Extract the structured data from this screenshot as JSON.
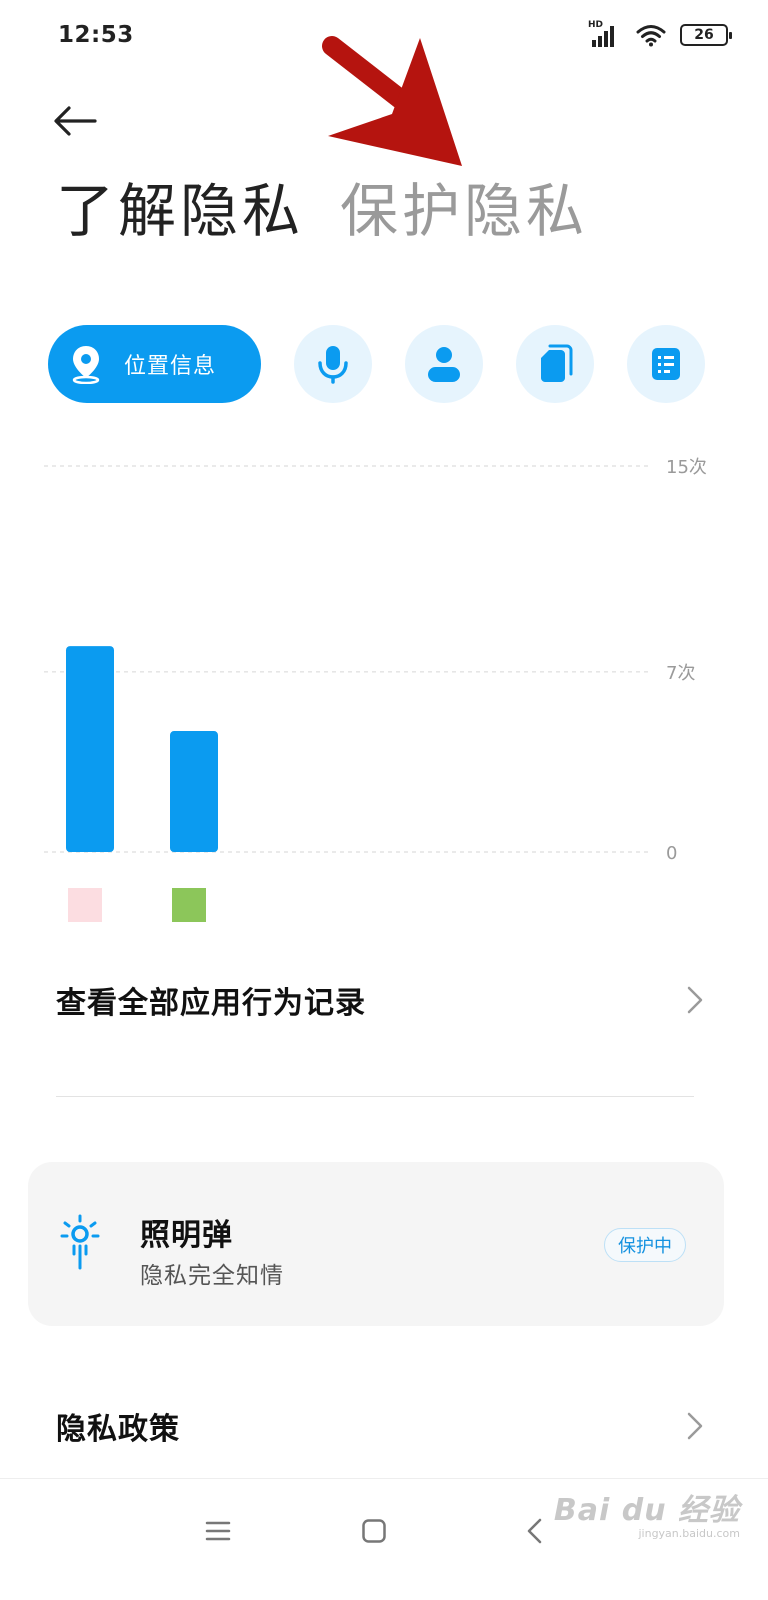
{
  "status_bar": {
    "time": "12:53",
    "network_label": "HD",
    "battery": "26",
    "icons": [
      "signal-icon",
      "wifi-icon",
      "battery-icon"
    ]
  },
  "header": {
    "back_icon": "arrow-left-icon",
    "tabs": [
      {
        "label": "了解隐私",
        "active": true
      },
      {
        "label": "保护隐私",
        "active": false
      }
    ]
  },
  "categories": [
    {
      "label": "位置信息",
      "icon": "location-pin-icon",
      "active": true
    },
    {
      "label": "",
      "icon": "microphone-icon",
      "active": false
    },
    {
      "label": "",
      "icon": "contact-person-icon",
      "active": false
    },
    {
      "label": "",
      "icon": "files-icon",
      "active": false
    },
    {
      "label": "",
      "icon": "list-document-icon",
      "active": false
    }
  ],
  "chart_data": {
    "type": "bar",
    "values": [
      8,
      4.7
    ],
    "categories": [
      "",
      ""
    ],
    "category_colors": [
      "#fcdde1",
      "#8cc65a"
    ],
    "bar_color": "#0b9bf0",
    "y_ticks": [
      "15次",
      "7次",
      "0"
    ],
    "y_tick_values": [
      15,
      7,
      0
    ],
    "ylim": [
      0,
      15
    ],
    "grid": true
  },
  "rows": {
    "all_records": {
      "label": "查看全部应用行为记录"
    },
    "privacy_policy": {
      "label": "隐私政策"
    }
  },
  "feature_card": {
    "title": "照明弹",
    "subtitle": "隐私完全知情",
    "status": "保护中",
    "icon": "flare-icon"
  },
  "nav_bar": {
    "icons": [
      "menu-icon",
      "home-square-icon",
      "back-chevron-icon"
    ]
  },
  "watermark": {
    "brand": "Bai du 经验",
    "url": "jingyan.baidu.com"
  },
  "colors": {
    "accent": "#0b9bf0",
    "chip_bg": "#e6f4fd",
    "annotation_arrow": "#b5140f"
  }
}
